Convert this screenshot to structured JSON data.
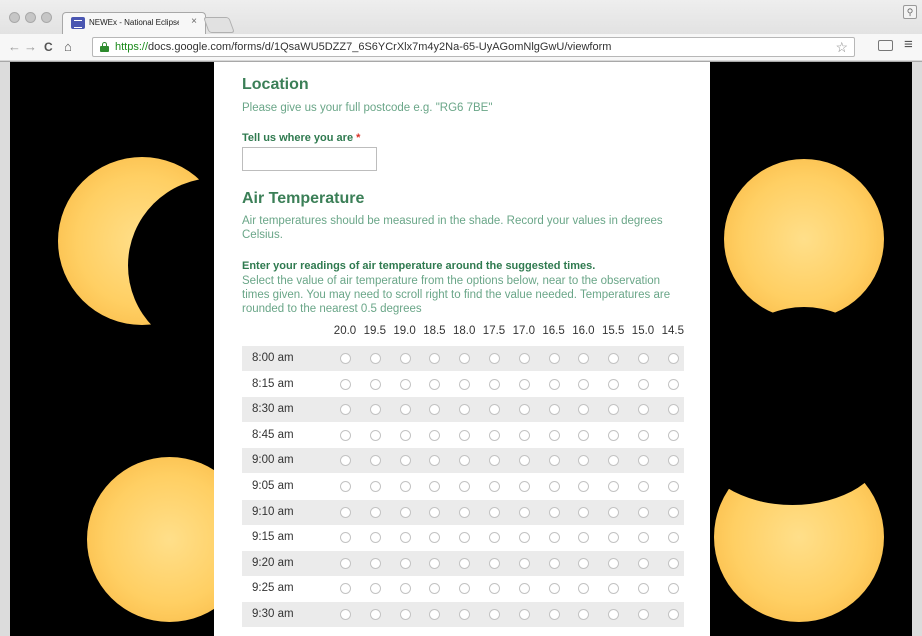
{
  "browser": {
    "tab_title": "NEWEx - National Eclipse",
    "tab_close": "×",
    "url_scheme": "https://",
    "url_rest": "docs.google.com/forms/d/1QsaWU5DZZ7_6S6YCrXlx7m4y2Na-65-UyAGomNlgGwU/viewform",
    "back_glyph": "←",
    "forward_glyph": "→",
    "reload_glyph": "C",
    "home_glyph": "⌂",
    "star_glyph": "☆",
    "menu_glyph": "≡",
    "profile_glyph": "⚲",
    "icons": [
      "close-window-icon",
      "minimize-window-icon",
      "zoom-window-icon",
      "forms-favicon-icon",
      "back-arrow-icon",
      "forward-arrow-icon",
      "reload-icon",
      "home-icon",
      "lock-icon",
      "bookmark-star-icon",
      "cast-icon",
      "menu-icon",
      "profile-icon"
    ]
  },
  "form": {
    "location": {
      "title": "Location",
      "help": "Please give us your full postcode e.g. \"RG6 7BE\"",
      "question": "Tell us where you are",
      "required_mark": "*",
      "value": ""
    },
    "air": {
      "title": "Air Temperature",
      "help_line1": "Air temperatures should be measured in the shade. Record your values in degrees",
      "help_line2": "Celsius.",
      "question": "Enter your readings of air temperature around the suggested times.",
      "desc_line1": "Select the value of air temperature from the options below, near to the observation",
      "desc_line2": "times given. You may need to scroll right to find the value needed. Temperatures are",
      "desc_line3": "rounded to the nearest 0.5 degrees"
    },
    "grid": {
      "columns": [
        "20.0",
        "19.5",
        "19.0",
        "18.5",
        "18.0",
        "17.5",
        "17.0",
        "16.5",
        "16.0",
        "15.5",
        "15.0",
        "14.5"
      ],
      "rows": [
        "8:00 am",
        "8:15 am",
        "8:30 am",
        "8:45 am",
        "9:00 am",
        "9:05 am",
        "9:10 am",
        "9:15 am",
        "9:20 am",
        "9:25 am",
        "9:30 am"
      ]
    }
  }
}
